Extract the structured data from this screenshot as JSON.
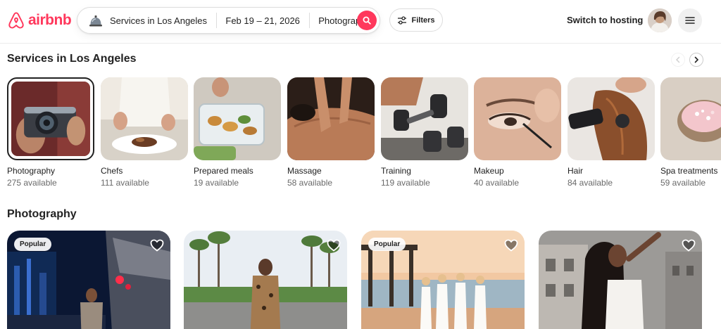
{
  "header": {
    "logo_text": "airbnb",
    "search": {
      "service": "Services in Los Angeles",
      "dates": "Feb 19 – 21, 2026",
      "category": "Photography"
    },
    "filters_label": "Filters",
    "host_link": "Switch to hosting"
  },
  "colors": {
    "brand": "#ff385c",
    "text": "#222222",
    "muted": "#6a6a6a"
  },
  "section_services": {
    "title": "Services in Los Angeles",
    "categories": [
      {
        "name": "Photography",
        "count": "275 available",
        "selected": true
      },
      {
        "name": "Chefs",
        "count": "111 available"
      },
      {
        "name": "Prepared meals",
        "count": "19 available"
      },
      {
        "name": "Massage",
        "count": "58 available"
      },
      {
        "name": "Training",
        "count": "119 available"
      },
      {
        "name": "Makeup",
        "count": "40 available"
      },
      {
        "name": "Hair",
        "count": "84 available"
      },
      {
        "name": "Spa treatments",
        "count": "59 available"
      }
    ]
  },
  "section_photography": {
    "title": "Photography",
    "listings": [
      {
        "badge": "Popular"
      },
      {
        "badge": ""
      },
      {
        "badge": "Popular"
      },
      {
        "badge": ""
      }
    ]
  }
}
